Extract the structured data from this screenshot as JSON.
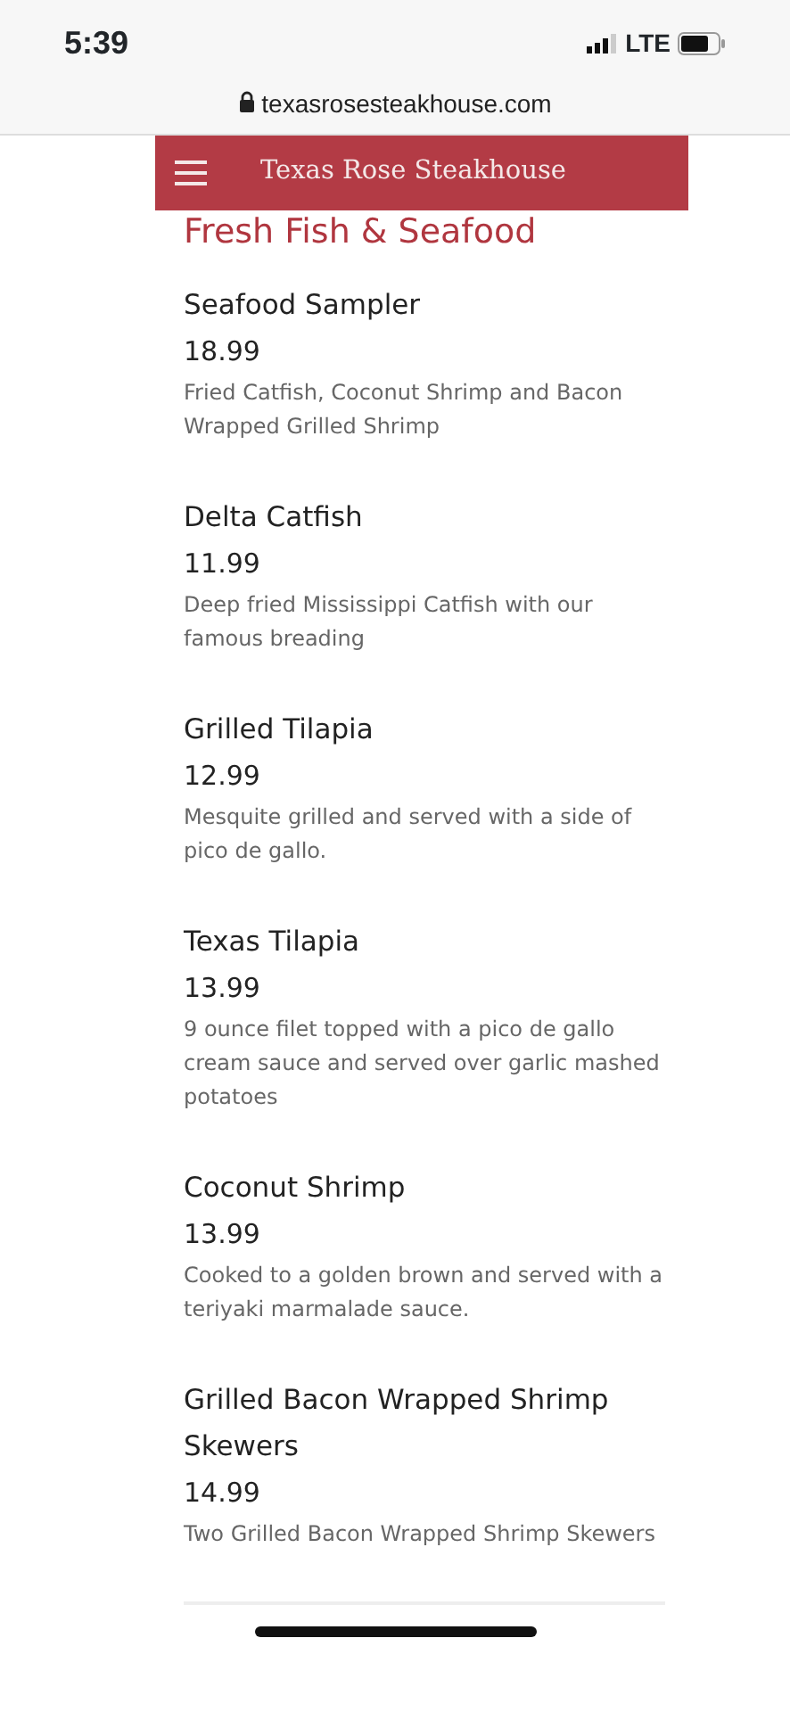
{
  "status_bar": {
    "time": "5:39",
    "network": "LTE"
  },
  "address_bar": {
    "url": "texasrosesteakhouse.com"
  },
  "navbar": {
    "title": "Texas Rose Steakhouse"
  },
  "section": {
    "title": "Fresh Fish & Seafood"
  },
  "items": [
    {
      "name": "Seafood Sampler",
      "price": "18.99",
      "description": "Fried Catfish, Coconut Shrimp and Bacon Wrapped Grilled Shrimp"
    },
    {
      "name": "Delta Catfish",
      "price": "11.99",
      "description": "Deep fried Mississippi Catfish with our famous breading"
    },
    {
      "name": "Grilled Tilapia",
      "price": "12.99",
      "description": "Mesquite grilled and served with a side of pico de gallo."
    },
    {
      "name": "Texas Tilapia",
      "price": "13.99",
      "description": "9 ounce filet topped with a pico de gallo cream sauce and served over garlic mashed potatoes"
    },
    {
      "name": "Coconut Shrimp",
      "price": "13.99",
      "description": "Cooked to a golden brown and served with a teriyaki marmalade sauce."
    },
    {
      "name": "Grilled Bacon Wrapped Shrimp Skewers",
      "price": "14.99",
      "description": "Two Grilled Bacon Wrapped Shrimp Skewers"
    }
  ]
}
